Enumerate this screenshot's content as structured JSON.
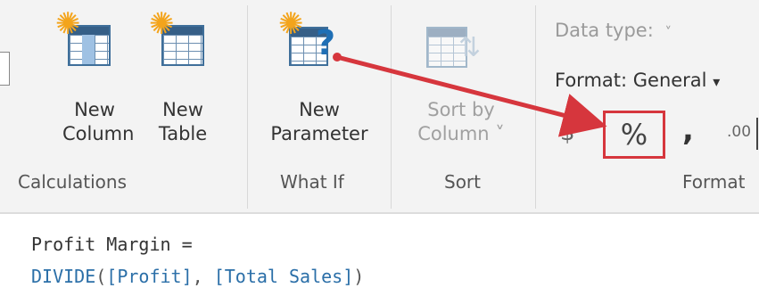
{
  "ribbon": {
    "calculations": {
      "new_column": {
        "line1": "New",
        "line2": "Column"
      },
      "new_table": {
        "line1": "New",
        "line2": "Table"
      },
      "group_label": "Calculations"
    },
    "what_if": {
      "new_parameter": {
        "line1": "New",
        "line2": "Parameter"
      },
      "group_label": "What If"
    },
    "sort": {
      "sort_by_column": {
        "line1": "Sort by",
        "line2": "Column ˅"
      },
      "group_label": "Sort"
    },
    "formatting": {
      "data_type_label": "Data type:",
      "data_type_caret": "˅",
      "format_label": "Format: General",
      "format_caret": "▾",
      "currency_symbol": "$",
      "percent_symbol": "%",
      "comma_symbol": ",",
      "decimal_symbol": ".00",
      "group_label": "Format"
    }
  },
  "formula": {
    "line1": "Profit Margin =",
    "func": "DIVIDE",
    "open_paren": "(",
    "arg1": "[Profit]",
    "separator": ", ",
    "arg2": "[Total Sales]",
    "close_paren": ")"
  },
  "colors": {
    "accent_red": "#d6363d",
    "icon_blue": "#365f87",
    "sun": "#f3a41c"
  },
  "icons": [
    "new-column-icon",
    "new-table-icon",
    "new-parameter-icon",
    "sort-by-column-icon"
  ]
}
